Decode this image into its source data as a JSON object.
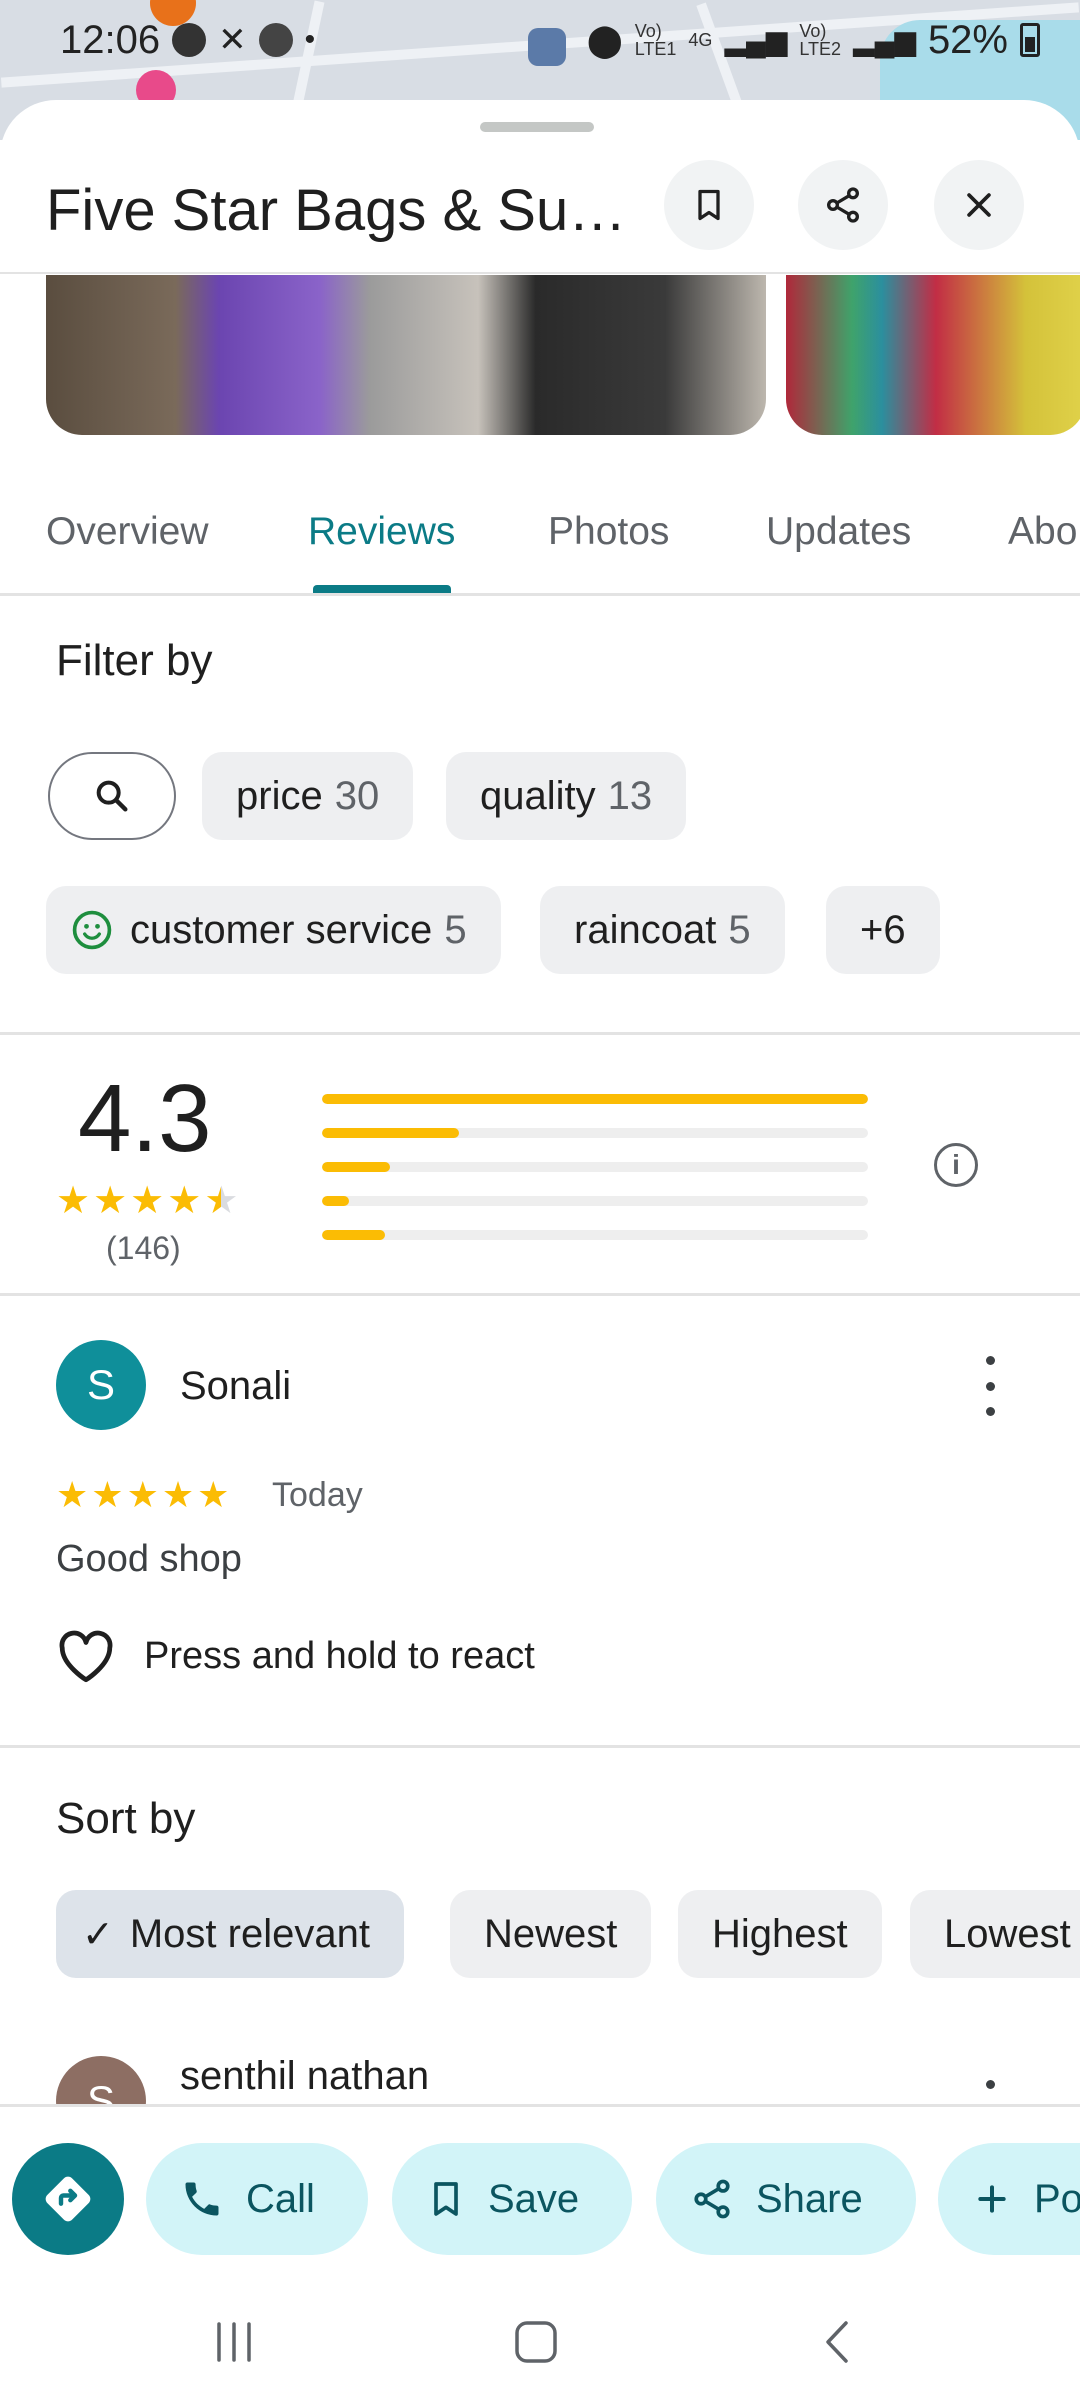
{
  "status_bar": {
    "time": "12:06",
    "network_1": "4G",
    "battery": "52%"
  },
  "header": {
    "title": "Five Star Bags & Su…",
    "save_icon": "bookmark-icon",
    "share_icon": "share-icon",
    "close_icon": "close-icon"
  },
  "tabs": [
    {
      "label": "Overview",
      "active": false
    },
    {
      "label": "Reviews",
      "active": true
    },
    {
      "label": "Photos",
      "active": false
    },
    {
      "label": "Updates",
      "active": false
    },
    {
      "label": "Abo",
      "active": false
    }
  ],
  "filter": {
    "title": "Filter by",
    "chips": [
      {
        "label": "price",
        "count": "30"
      },
      {
        "label": "quality",
        "count": "13"
      },
      {
        "label": "customer service",
        "count": "5",
        "icon": "smiley-icon"
      },
      {
        "label": "raincoat",
        "count": "5"
      },
      {
        "label": "+6"
      }
    ]
  },
  "rating": {
    "value": "4.3",
    "count": "(146)",
    "stars": "★★★★★",
    "distribution": [
      1.0,
      0.25,
      0.125,
      0.05,
      0.115
    ]
  },
  "review": {
    "avatar_letter": "S",
    "name": "Sonali",
    "stars": "★★★★★",
    "date": "Today",
    "text": "Good shop",
    "react_label": "Press and hold to react"
  },
  "sort": {
    "title": "Sort by",
    "options": [
      {
        "label": "Most relevant",
        "selected": true
      },
      {
        "label": "Newest"
      },
      {
        "label": "Highest"
      },
      {
        "label": "Lowest"
      }
    ]
  },
  "next_review": {
    "avatar_letter": "S",
    "name": "senthil nathan"
  },
  "actions": {
    "directions_icon": "directions-icon",
    "call": "Call",
    "save": "Save",
    "share": "Share",
    "post": "Po"
  },
  "colors": {
    "accent": "#0b7b86",
    "star": "#fbbc04",
    "action_pill": "#d2f4f8"
  }
}
